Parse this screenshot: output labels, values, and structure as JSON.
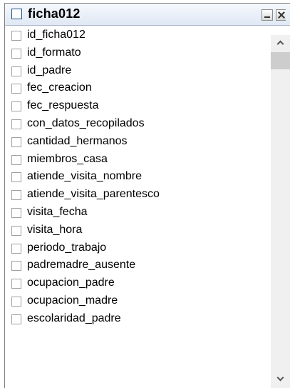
{
  "window": {
    "title": "ficha012",
    "minimize_icon": "minimize-icon",
    "close_icon": "close-icon"
  },
  "columns": [
    "id_ficha012",
    "id_formato",
    "id_padre",
    "fec_creacion",
    "fec_respuesta",
    "con_datos_recopilados",
    "cantidad_hermanos",
    "miembros_casa",
    "atiende_visita_nombre",
    "atiende_visita_parentesco",
    "visita_fecha",
    "visita_hora",
    "periodo_trabajo",
    "padremadre_ausente",
    "ocupacion_padre",
    "ocupacion_madre",
    "escolaridad_padre"
  ],
  "scrollbar": {
    "up_icon": "chevron-up-icon",
    "down_icon": "chevron-down-icon"
  },
  "colors": {
    "title_gradient_top": "#f6f9fd",
    "title_gradient_bottom": "#dfe8f4",
    "title_checkbox_border": "#1c5180",
    "scroll_track": "#f0f0f0",
    "scroll_thumb": "#cdcdcd"
  }
}
